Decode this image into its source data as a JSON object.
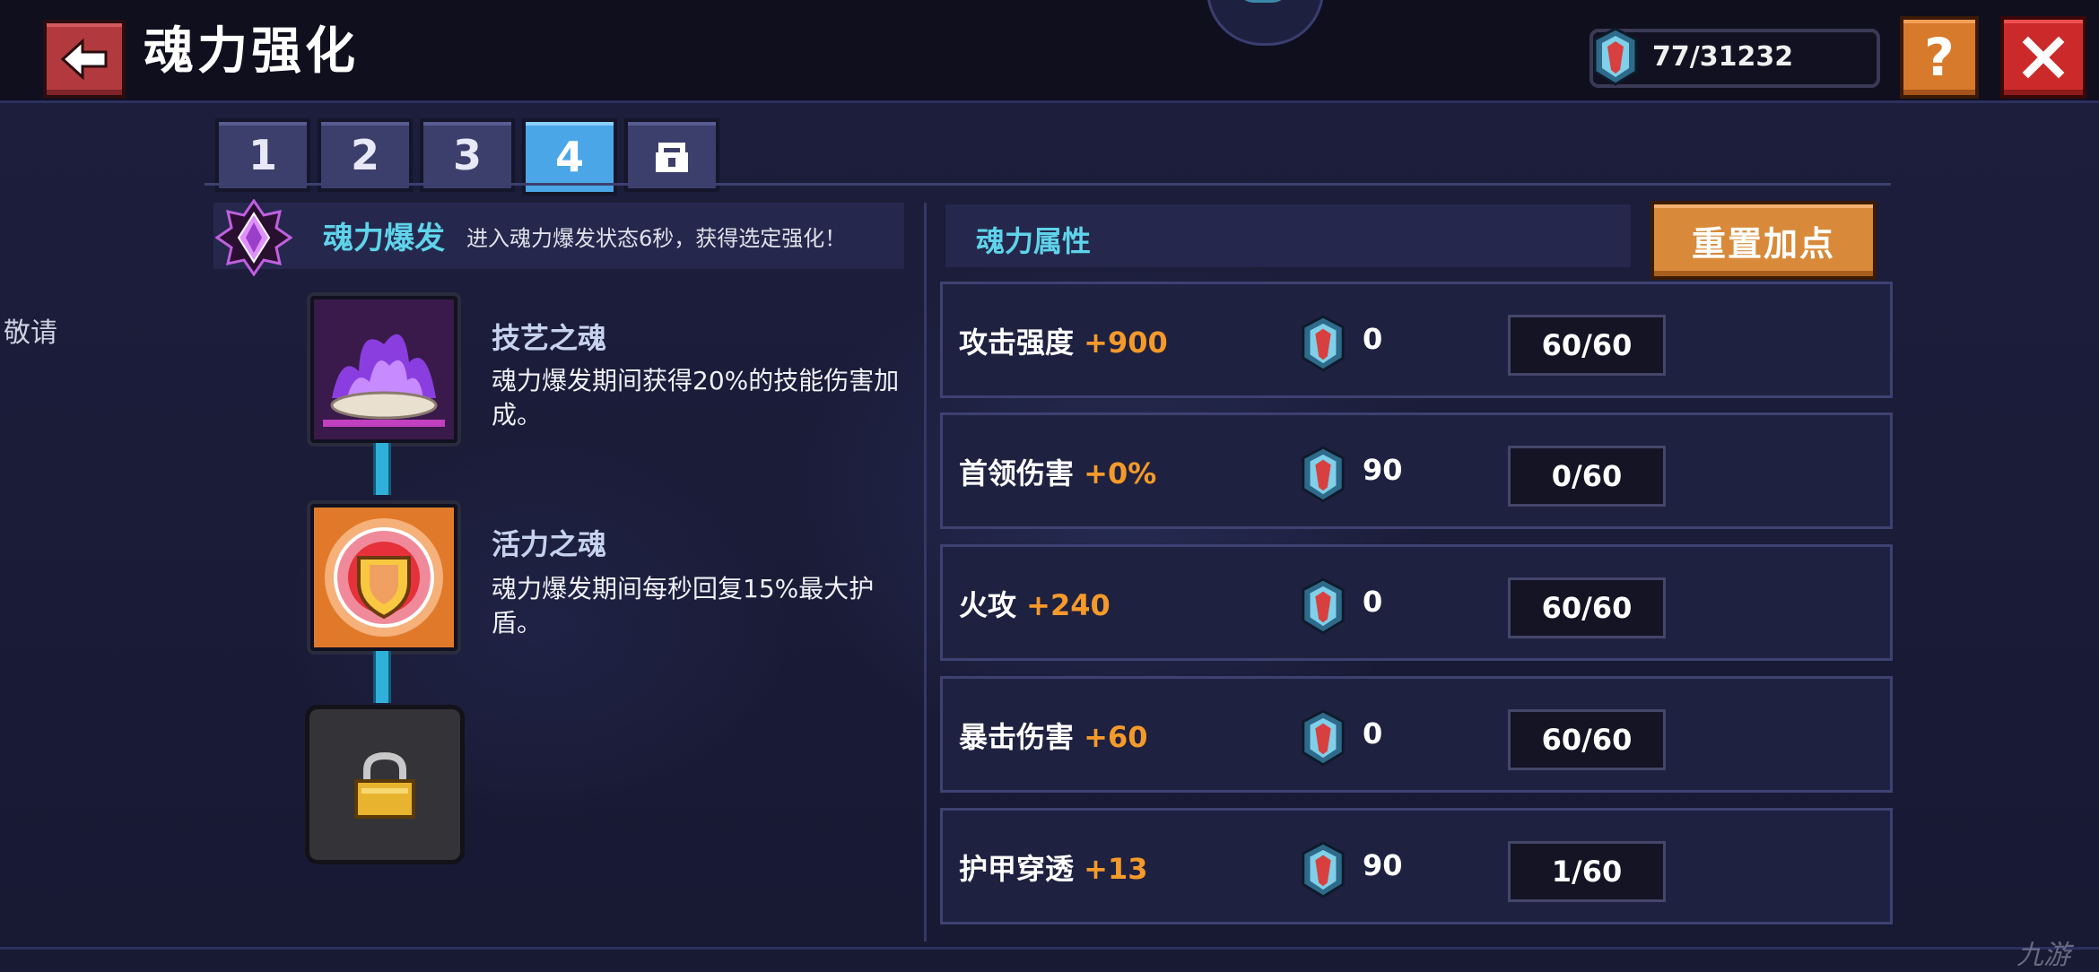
{
  "header": {
    "title": "魂力强化",
    "currency_value": "77/31232"
  },
  "side_text": "敬请",
  "tabs": [
    {
      "label": "1",
      "active": false
    },
    {
      "label": "2",
      "active": false
    },
    {
      "label": "3",
      "active": false
    },
    {
      "label": "4",
      "active": true
    },
    {
      "label": "",
      "icon": "lock-icon",
      "active": false
    }
  ],
  "soul_burst": {
    "title": "魂力爆发",
    "description": "进入魂力爆发状态6秒，获得选定强化！",
    "nodes": [
      {
        "name": "技艺之魂",
        "description": "魂力爆发期间获得20%的技能伤害加成。",
        "icon": "purple-flame-icon"
      },
      {
        "name": "活力之魂",
        "description": "魂力爆发期间每秒回复15%最大护盾。",
        "icon": "shield-emblem-icon"
      },
      {
        "name": "",
        "description": "",
        "icon": "lock-icon",
        "locked": true
      }
    ]
  },
  "attributes": {
    "title": "魂力属性",
    "reset_label": "重置加点",
    "rows": [
      {
        "name": "攻击强度",
        "bonus": "+900",
        "cost": "0",
        "level": "60/60"
      },
      {
        "name": "首领伤害",
        "bonus": "+0%",
        "cost": "90",
        "level": "0/60"
      },
      {
        "name": "火攻",
        "bonus": "+240",
        "cost": "0",
        "level": "60/60"
      },
      {
        "name": "暴击伤害",
        "bonus": "+60",
        "cost": "0",
        "level": "60/60"
      },
      {
        "name": "护甲穿透",
        "bonus": "+13",
        "cost": "90",
        "level": "1/60"
      }
    ]
  },
  "watermark": "九游",
  "colors": {
    "accent_cyan": "#5fd3ea",
    "bonus_orange": "#f59a2a",
    "tab_active": "#4aa6e6",
    "reset_orange": "#d88a3a",
    "close_red": "#cc2a2a"
  }
}
